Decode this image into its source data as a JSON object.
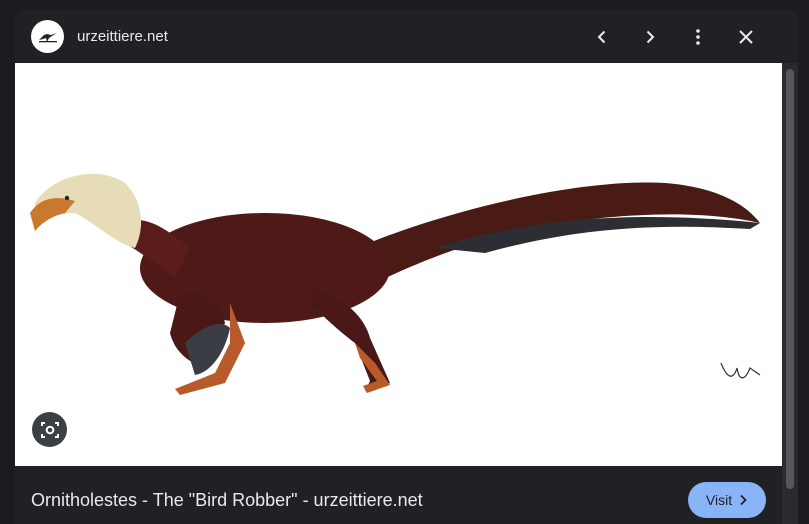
{
  "header": {
    "site_name": "urzeittiere.net",
    "favicon_icon": "dinosaur-logo-icon",
    "prev_icon": "chevron-left-icon",
    "next_icon": "chevron-right-icon",
    "more_icon": "more-vert-icon",
    "close_icon": "close-icon"
  },
  "image": {
    "subject": "dinosaur-illustration",
    "lens_icon": "lens-search-icon"
  },
  "caption": {
    "title": "Ornitholestes - The \"Bird Robber\" - urzeittiere.net",
    "visit_label": "Visit",
    "visit_icon": "chevron-right-icon"
  },
  "colors": {
    "background": "#1b1c20",
    "panel": "#202124",
    "accent": "#8ab4f8",
    "text": "#e8eaed"
  }
}
